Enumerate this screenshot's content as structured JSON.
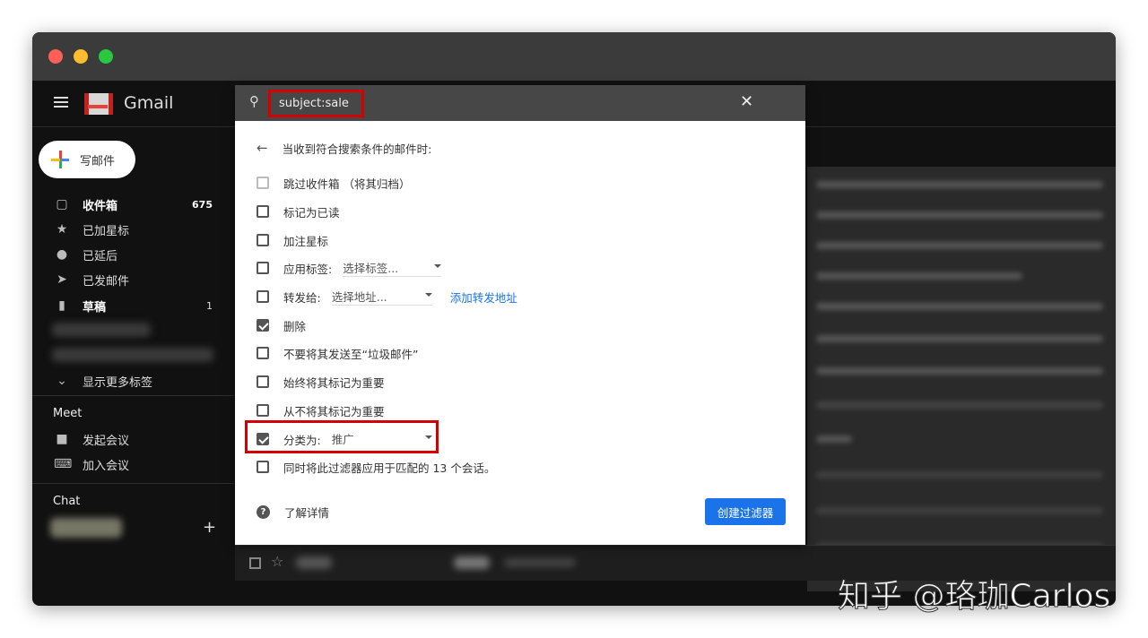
{
  "window": {
    "traffic_colors": [
      "#fe5f57",
      "#febc2e",
      "#28c840"
    ]
  },
  "header": {
    "brand": "Gmail"
  },
  "sidebar": {
    "compose": "写邮件",
    "items": [
      {
        "icon": "inbox-icon",
        "label": "收件箱",
        "count": "675",
        "bold": true
      },
      {
        "icon": "star-icon",
        "label": "已加星标",
        "count": ""
      },
      {
        "icon": "clock-icon",
        "label": "已延后",
        "count": ""
      },
      {
        "icon": "send-icon",
        "label": "已发邮件",
        "count": ""
      },
      {
        "icon": "draft-icon",
        "label": "草稿",
        "count": "1",
        "bold": true
      }
    ],
    "more": "显示更多标签",
    "meet_title": "Meet",
    "meet_items": [
      "发起会议",
      "加入会议"
    ],
    "chat_title": "Chat"
  },
  "search": {
    "query": "subject:sale"
  },
  "filter": {
    "heading": "当收到符合搜索条件的邮件时:",
    "options": [
      {
        "label": "跳过收件箱 （将其归档）",
        "checked": false,
        "disabled": true
      },
      {
        "label": "标记为已读",
        "checked": false
      },
      {
        "label": "加注星标",
        "checked": false
      },
      {
        "label": "应用标签:",
        "checked": false,
        "select": "选择标签..."
      },
      {
        "label": "转发给:",
        "checked": false,
        "select": "选择地址...",
        "link": "添加转发地址"
      },
      {
        "label": "删除",
        "checked": true
      },
      {
        "label": "不要将其发送至“垃圾邮件”",
        "checked": false
      },
      {
        "label": "始终将其标记为重要",
        "checked": false
      },
      {
        "label": "从不将其标记为重要",
        "checked": false
      },
      {
        "label": "分类为:",
        "checked": true,
        "select": "推广"
      },
      {
        "label": "同时将此过滤器应用于匹配的 13 个会话。",
        "checked": false
      }
    ],
    "help": "了解详情",
    "create": "创建过滤器"
  },
  "watermark": "知乎 @珞珈Carlos"
}
